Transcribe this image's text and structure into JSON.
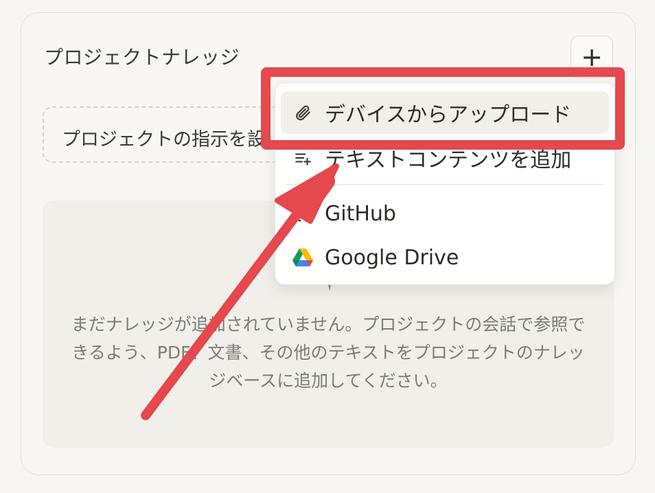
{
  "panel": {
    "title": "プロジェクトナレッジ",
    "add_button_label": "+"
  },
  "instructions": {
    "placeholder": "プロジェクトの指示を設"
  },
  "empty_state": {
    "message": "まだナレッジが追加されていません。プロジェクトの会話で参照できるよう、PDF、文書、その他のテキストをプロジェクトのナレッジベースに追加してください。"
  },
  "menu": {
    "items": [
      {
        "label": "デバイスからアップロード",
        "icon": "paperclip-icon"
      },
      {
        "label": "テキストコンテンツを追加",
        "icon": "add-text-icon"
      },
      {
        "label": "GitHub",
        "icon": "github-icon"
      },
      {
        "label": "Google Drive",
        "icon": "google-drive-icon"
      }
    ]
  },
  "annotation": {
    "highlight_color": "#e5484d"
  }
}
